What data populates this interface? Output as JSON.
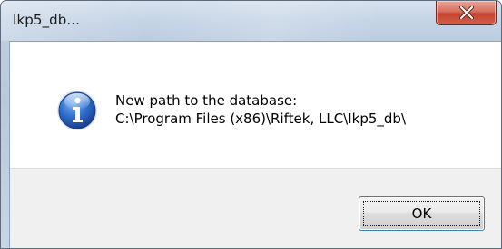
{
  "window": {
    "title": "Ikp5_db..."
  },
  "titlebar": {
    "close_icon": "close-icon"
  },
  "message": {
    "icon": "info-icon",
    "line1": "New path to the database:",
    "line2": "C:\\Program Files (x86)\\Riftek, LLC\\Ikp5_db\\"
  },
  "buttons": {
    "ok_label": "OK"
  },
  "colors": {
    "accent": "#3c7fb1",
    "close": "#c4432f",
    "footer": "#f0f0f0"
  }
}
